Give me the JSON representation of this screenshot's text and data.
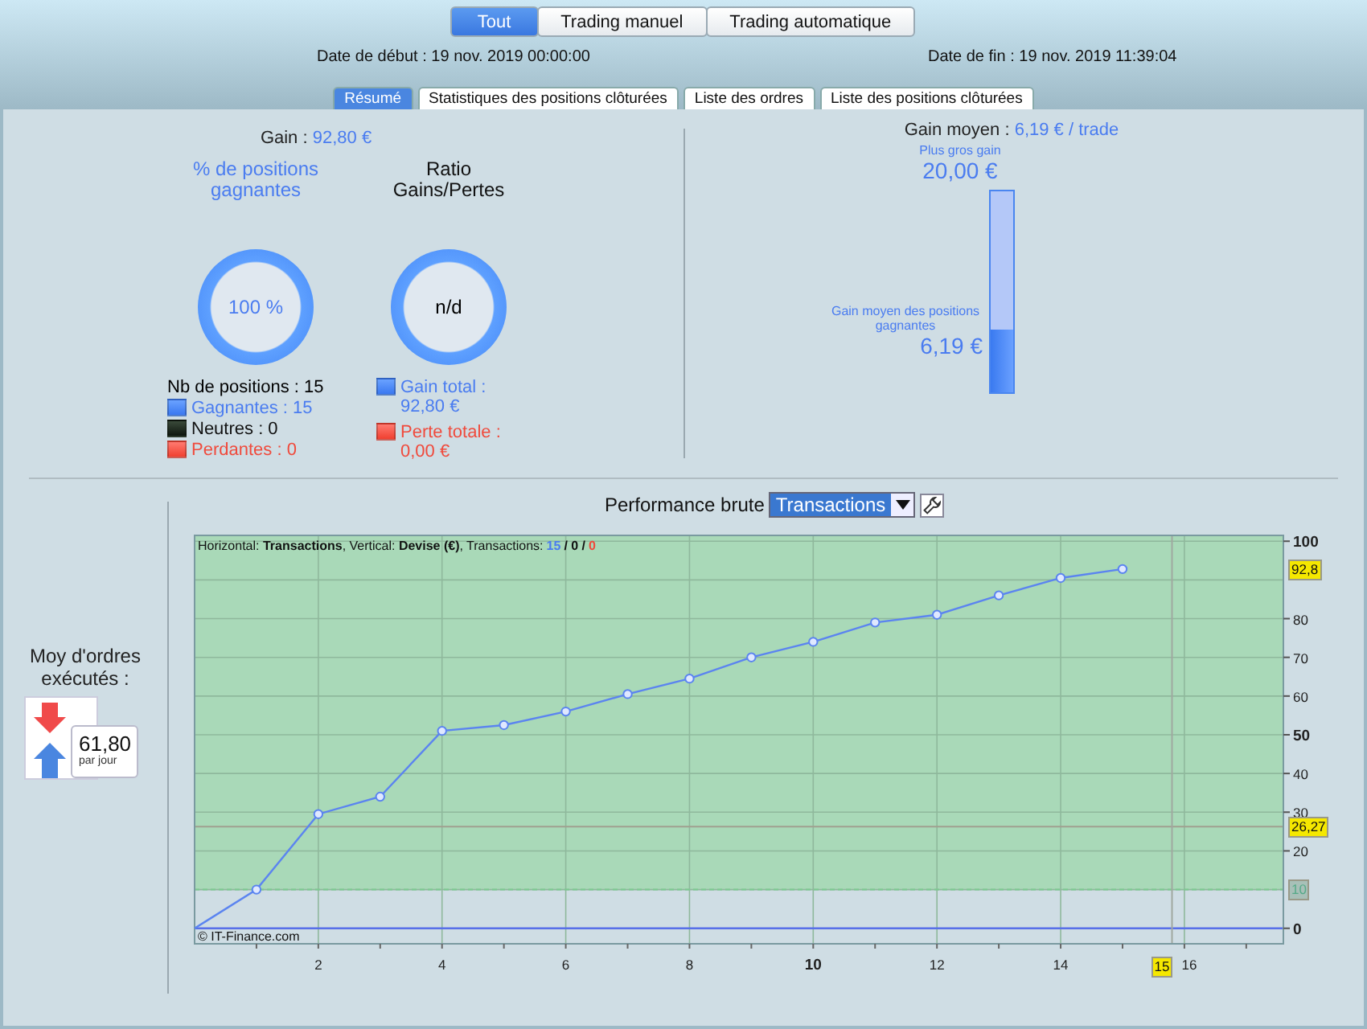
{
  "mode_tabs": [
    {
      "label": "Tout",
      "selected": true
    },
    {
      "label": "Trading manuel",
      "selected": false
    },
    {
      "label": "Trading automatique",
      "selected": false
    }
  ],
  "start_date": {
    "label": "Date de début :",
    "value": "19 nov. 2019 00:00:00"
  },
  "end_date": {
    "label": "Date de fin :",
    "value": "19 nov. 2019 11:39:04"
  },
  "tabs": [
    {
      "label": "Résumé",
      "selected": true
    },
    {
      "label": "Statistiques des positions clôturées",
      "selected": false
    },
    {
      "label": "Liste des ordres",
      "selected": false
    },
    {
      "label": "Liste des positions clôturées",
      "selected": false
    }
  ],
  "summary": {
    "gain": {
      "label": "Gain :",
      "value": "92,80 €"
    },
    "win_rate": {
      "title": "% de positions gagnantes",
      "value": "100 %"
    },
    "ratio": {
      "title": "Ratio Gains/Pertes",
      "value": "n/d"
    },
    "positions_label": "Nb de positions : 15",
    "legend": [
      {
        "text": "Gagnantes : 15",
        "kind": "win"
      },
      {
        "text": "Neutres : 0",
        "kind": "neutral"
      },
      {
        "text": "Perdantes : 0",
        "kind": "loss"
      }
    ],
    "totals": [
      {
        "text": "Gain total : 92,80 €",
        "kind": "win"
      },
      {
        "text": "Perte totale : 0,00 €",
        "kind": "loss"
      }
    ]
  },
  "average": {
    "label": "Gain moyen :",
    "value": "6,19 € / trade",
    "max_label": "Plus gros gain",
    "max_value": "20,00 €",
    "mean_label": "Gain moyen des positions gagnantes",
    "mean_value": "6,19 €",
    "level": 0.31
  },
  "orders": {
    "label": "Moy d'ordres exécutés :",
    "value": "61,80",
    "unit": "par jour"
  },
  "performance": {
    "label": "Performance brute",
    "select": "Transactions",
    "header": "Horizontal: **Transactions**, Vertical: **Devise (€)**, Transactions:",
    "counts": [
      {
        "text": "15",
        "kind": "win"
      },
      {
        "text": "/ 0 /",
        "kind": "neutral"
      },
      {
        "text": "0",
        "kind": "loss"
      }
    ],
    "copyright": "© IT-Finance.com",
    "chart_data": {
      "type": "line",
      "x": [
        0,
        1,
        2,
        3,
        4,
        5,
        6,
        7,
        8,
        9,
        10,
        11,
        12,
        13,
        14,
        15
      ],
      "grid": true,
      "series": [
        {
          "color": "#5b84f0",
          "marker": "o",
          "values": [
            0,
            10,
            29.5,
            34,
            51,
            52.5,
            56,
            60.5,
            64.5,
            70,
            74,
            79,
            81,
            86,
            90.5,
            92.8
          ]
        }
      ],
      "xlim": [
        0,
        17.6
      ],
      "ylim": [
        -4,
        101.5
      ],
      "xticks": [
        2,
        4,
        6,
        8,
        {
          "value": 10,
          "label": "10"
        },
        12,
        14,
        16
      ],
      "yticks": [
        0,
        20,
        30,
        40,
        50,
        60,
        70,
        80,
        100
      ],
      "bands": [
        {
          "axis": "y",
          "from": 10,
          "to": 101.5,
          "color": "#a9d9b8"
        }
      ],
      "ref_lines": [
        {
          "axis": "y",
          "value": 0,
          "color": "#5870e8"
        },
        {
          "axis": "y",
          "value": 26.27,
          "label": "26,27",
          "color": "#a0a090"
        },
        {
          "axis": "y",
          "value": 10,
          "label": "10",
          "color": "#7cc890"
        },
        {
          "axis": "x",
          "value": 15.8,
          "color": "#a0a8a0"
        }
      ],
      "annotations": [
        "92,8",
        "15"
      ]
    }
  }
}
